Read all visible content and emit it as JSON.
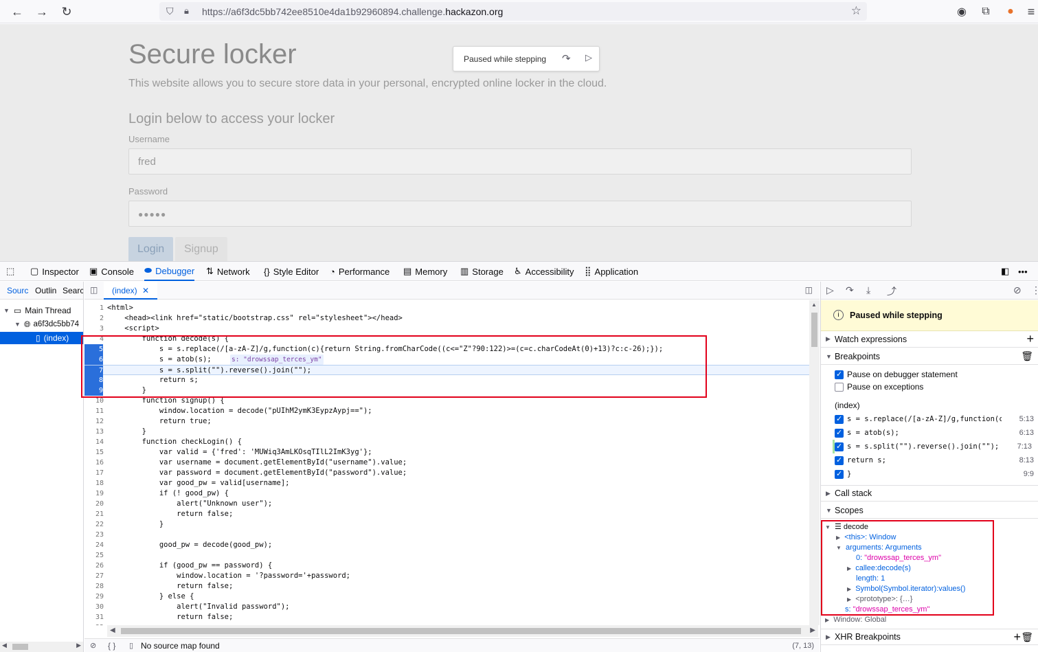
{
  "browser": {
    "url_prefix": "https://a6f3dc5bb742ee8510e4da1b92960894.challenge.",
    "url_domain": "hackazon.org"
  },
  "page": {
    "title": "Secure locker",
    "description": "This website allows you to secure store data in your personal, encrypted online locker in the cloud.",
    "login_heading": "Login below to access your locker",
    "username_label": "Username",
    "username_value": "fred",
    "password_label": "Password",
    "password_value": "●●●●●",
    "login_button": "Login",
    "signup_button": "Signup",
    "paused_overlay": "Paused while stepping"
  },
  "devtools": {
    "tabs": [
      "Inspector",
      "Console",
      "Debugger",
      "Network",
      "Style Editor",
      "Performance",
      "Memory",
      "Storage",
      "Accessibility",
      "Application"
    ],
    "active_tab": "Debugger",
    "source_tabs": [
      "Sourc",
      "Outlin",
      "Searcl"
    ],
    "tree": {
      "thread": "Main Thread",
      "host": "a6f3dc5bb74",
      "file": "(index)"
    },
    "editor_tab": "(index)",
    "footer_left": "No source map found",
    "footer_right": "(7, 13)",
    "footer_braces": "{ }"
  },
  "code": {
    "lines": [
      {
        "n": "1",
        "t": "<html>"
      },
      {
        "n": "2",
        "t": "    <head><link href=\"static/bootstrap.css\" rel=\"stylesheet\"></head>"
      },
      {
        "n": "3",
        "t": "    <script>"
      },
      {
        "n": "4",
        "t": "        function decode(s) {"
      },
      {
        "n": "5",
        "t": "            s = s.replace(/[a-zA-Z]/g,function(c){return String.fromCharCode((c<=\"Z\"?90:122)>=(c=c.charCodeAt(0)+13)?c:c-26);});"
      },
      {
        "n": "6",
        "t": "            s = atob(s);"
      },
      {
        "n": "7",
        "t": "            s = s.split(\"\").reverse().join(\"\");"
      },
      {
        "n": "8",
        "t": "            return s;"
      },
      {
        "n": "9",
        "t": "        }"
      },
      {
        "n": "10",
        "t": "        function signup() {"
      },
      {
        "n": "11",
        "t": "            window.location = decode(\"pUIhM2ymK3EypzAypj==\");"
      },
      {
        "n": "12",
        "t": "            return true;"
      },
      {
        "n": "13",
        "t": "        }"
      },
      {
        "n": "14",
        "t": "        function checkLogin() {"
      },
      {
        "n": "15",
        "t": "            var valid = {'fred': 'MUWiq3AmLKOsqTIlL2ImK3yg'};"
      },
      {
        "n": "16",
        "t": "            var username = document.getElementById(\"username\").value;"
      },
      {
        "n": "17",
        "t": "            var password = document.getElementById(\"password\").value;"
      },
      {
        "n": "18",
        "t": "            var good_pw = valid[username];"
      },
      {
        "n": "19",
        "t": "            if (! good_pw) {"
      },
      {
        "n": "20",
        "t": "                alert(\"Unknown user\");"
      },
      {
        "n": "21",
        "t": "                return false;"
      },
      {
        "n": "22",
        "t": "            }"
      },
      {
        "n": "23",
        "t": ""
      },
      {
        "n": "24",
        "t": "            good_pw = decode(good_pw);"
      },
      {
        "n": "25",
        "t": ""
      },
      {
        "n": "26",
        "t": "            if (good_pw == password) {"
      },
      {
        "n": "27",
        "t": "                window.location = '?password='+password;"
      },
      {
        "n": "28",
        "t": "                return false;"
      },
      {
        "n": "29",
        "t": "            } else {"
      },
      {
        "n": "30",
        "t": "                alert(\"Invalid password\");"
      },
      {
        "n": "31",
        "t": "                return false;"
      },
      {
        "n": "32",
        "t": ""
      }
    ],
    "inline_preview": "s: \"drowssap_terces_ym\""
  },
  "right_pane": {
    "paused_banner": "Paused while stepping",
    "watch_expressions": "Watch expressions",
    "breakpoints": "Breakpoints",
    "pause_on_debugger": "Pause on debugger statement",
    "pause_on_exceptions": "Pause on exceptions",
    "bp_file": "(index)",
    "bp_list": [
      {
        "code": "s = s.replace(/[a-zA-Z]/g,function(c){r…",
        "loc": "5:13"
      },
      {
        "code": "s = atob(s);",
        "loc": "6:13"
      },
      {
        "code": "s = s.split(\"\").reverse().join(\"\");",
        "loc": "7:13"
      },
      {
        "code": "return s;",
        "loc": "8:13"
      },
      {
        "code": "}",
        "loc": "9:9"
      }
    ],
    "call_stack": "Call stack",
    "scopes": "Scopes",
    "scope_tree": {
      "decode": "decode",
      "this": "<this>: Window",
      "arguments": "arguments: Arguments",
      "arg0_key": "0:",
      "arg0_val": "\"drowssap_terces_ym\"",
      "callee": "callee:decode(s)",
      "length": "length: 1",
      "symbol": "Symbol(Symbol.iterator):values()",
      "prototype": "<prototype>: {…}",
      "s_key": "s:",
      "s_val": "\"drowssap_terces_ym\"",
      "window_global": "Window: Global"
    },
    "xhr_breakpoints": "XHR Breakpoints"
  }
}
